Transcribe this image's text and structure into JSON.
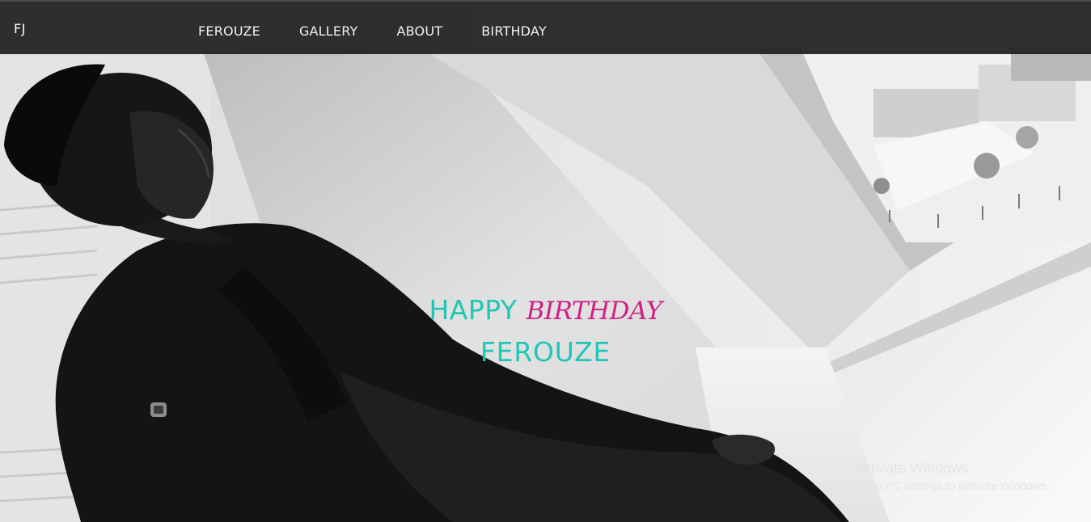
{
  "navbar": {
    "brand": "FJ",
    "links": [
      "FEROUZE",
      "GALLERY",
      "ABOUT",
      "BIRTHDAY"
    ]
  },
  "hero": {
    "headline_word1": "HAPPY",
    "headline_word2": "BIRTHDAY",
    "headline_name": "FEROUZE",
    "accent_teal": "#1fc7b6",
    "accent_pink": "#d01f85"
  },
  "watermark": {
    "title": "Activate Windows",
    "subtitle": "Go to PC settings to activate Windows."
  }
}
